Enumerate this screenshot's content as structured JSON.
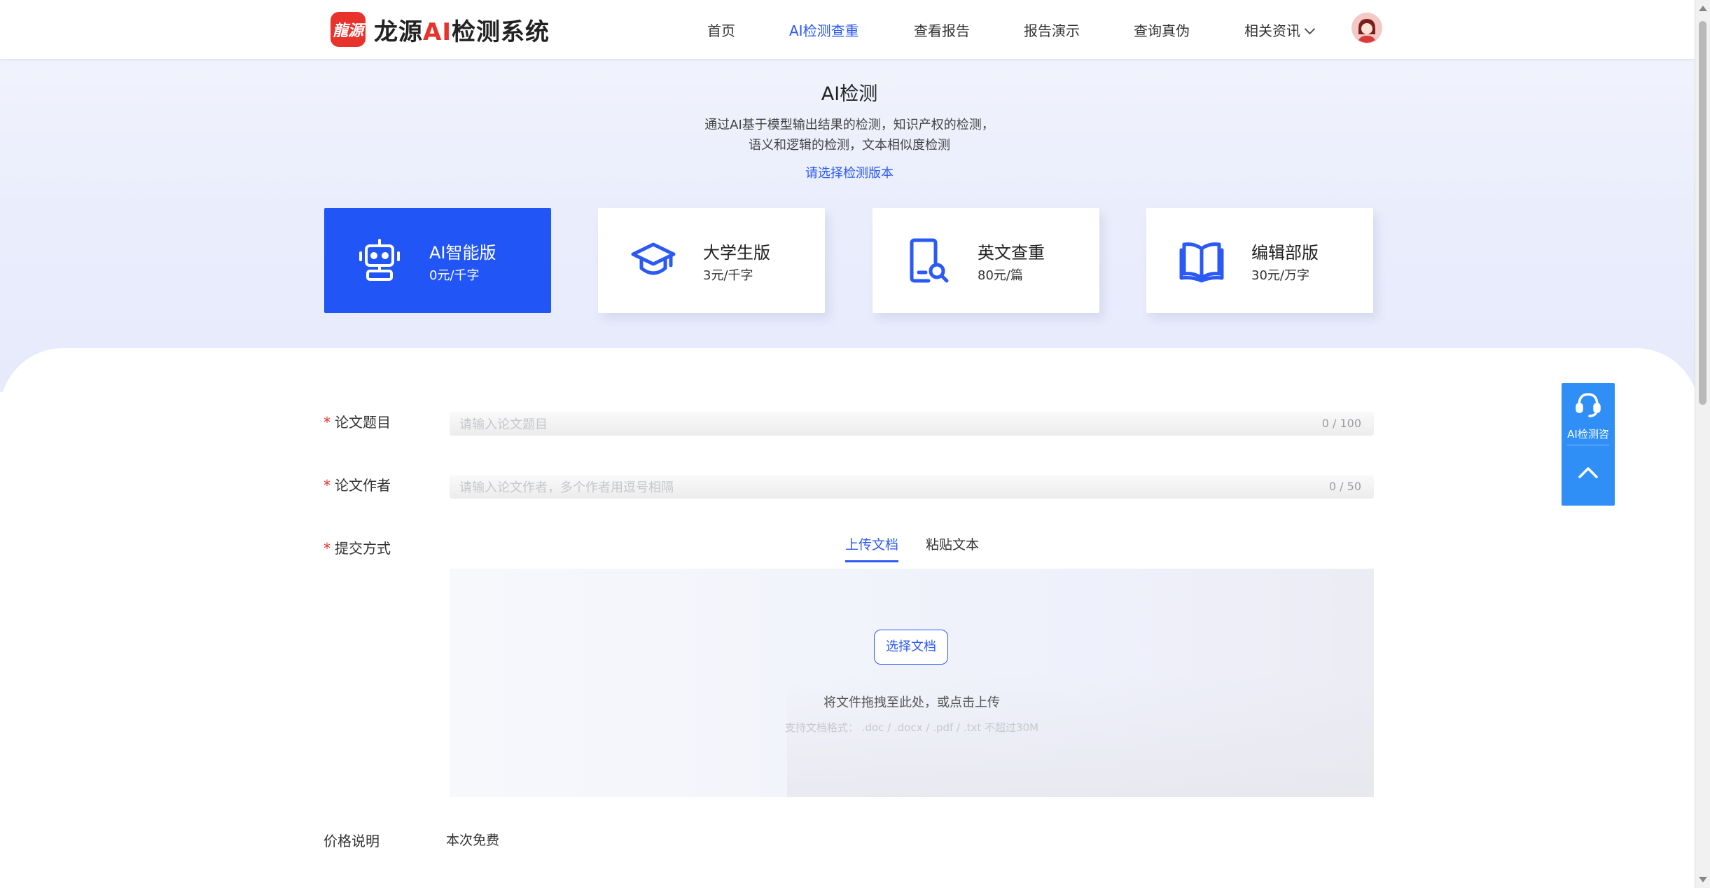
{
  "header": {
    "logo_mark": "龍源",
    "logo_text_prefix": "龙源",
    "logo_text_ai": "AI",
    "logo_text_suffix": "检测系统",
    "nav": [
      {
        "label": "首页"
      },
      {
        "label": "AI检测查重",
        "active": true
      },
      {
        "label": "查看报告"
      },
      {
        "label": "报告演示"
      },
      {
        "label": "查询真伪"
      },
      {
        "label": "相关资讯",
        "has_dropdown": true
      }
    ]
  },
  "hero": {
    "title": "AI检测",
    "subtitle_line1": "通过AI基于模型输出结果的检测，知识产权的检测，",
    "subtitle_line2": "语义和逻辑的检测，文本相似度检测",
    "select_link": "请选择检测版本"
  },
  "versions": [
    {
      "name": "AI智能版",
      "price": "0元/千字",
      "icon": "robot-icon",
      "active": true
    },
    {
      "name": "大学生版",
      "price": "3元/千字",
      "icon": "graduation-cap-icon"
    },
    {
      "name": "英文查重",
      "price": "80元/篇",
      "icon": "document-search-icon"
    },
    {
      "name": "编辑部版",
      "price": "30元/万字",
      "icon": "open-book-icon"
    }
  ],
  "form": {
    "required_mark": "*",
    "title_label": "论文题目",
    "title_placeholder": "请输入论文题目",
    "title_value": "",
    "title_count": "0 / 100",
    "author_label": "论文作者",
    "author_placeholder": "请输入论文作者，多个作者用逗号相隔",
    "author_value": "",
    "author_count": "0 / 50",
    "submit_label": "提交方式",
    "tabs": [
      {
        "label": "上传文档",
        "active": true
      },
      {
        "label": "粘贴文本"
      }
    ],
    "upload_button": "选择文档",
    "upload_hint": "将文件拖拽至此处，或点击上传",
    "upload_formats": "支持文档格式： .doc / .docx / .pdf / .txt 不超过30M",
    "price_label": "价格说明",
    "price_value": "本次免费"
  },
  "float_widget": {
    "consult_label": "AI检测咨",
    "consult_icon": "headset-icon",
    "top_icon": "chevron-up-icon"
  },
  "colors": {
    "primary": "#2b59f5",
    "card_active": "#2255f5",
    "logo_red": "#e8322c",
    "float_blue": "#2f8ff7"
  }
}
